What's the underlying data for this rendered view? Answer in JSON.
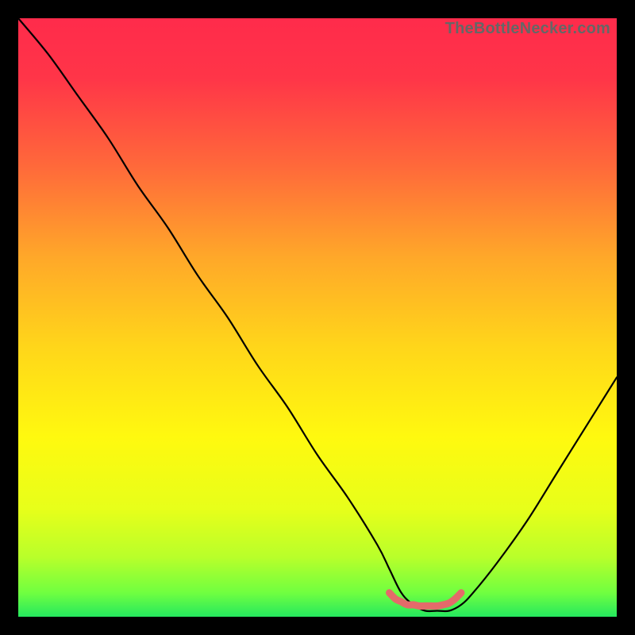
{
  "watermark": "TheBottleNecker.com",
  "chart_data": {
    "type": "line",
    "title": "",
    "xlabel": "",
    "ylabel": "",
    "xlim": [
      0,
      100
    ],
    "ylim": [
      0,
      100
    ],
    "series": [
      {
        "name": "bottleneck-curve",
        "x": [
          0,
          5,
          10,
          15,
          20,
          25,
          30,
          35,
          40,
          45,
          50,
          55,
          60,
          62,
          64,
          66,
          68,
          70,
          72,
          74,
          76,
          80,
          85,
          90,
          95,
          100
        ],
        "y": [
          100,
          94,
          87,
          80,
          72,
          65,
          57,
          50,
          42,
          35,
          27,
          20,
          12,
          8,
          4,
          2,
          1,
          1,
          1,
          2,
          4,
          9,
          16,
          24,
          32,
          40
        ]
      },
      {
        "name": "optimal-zone-marker",
        "x": [
          62,
          63,
          64,
          65,
          66,
          67,
          68,
          69,
          70,
          71,
          72,
          73,
          74
        ],
        "y": [
          4,
          3,
          2.5,
          2,
          2,
          1.8,
          1.8,
          1.8,
          1.8,
          2,
          2.3,
          3,
          4
        ]
      }
    ],
    "gradient_stops": [
      {
        "offset": 0.0,
        "color": "#ff2b4b"
      },
      {
        "offset": 0.1,
        "color": "#ff3548"
      },
      {
        "offset": 0.25,
        "color": "#ff6a3a"
      },
      {
        "offset": 0.4,
        "color": "#ffa829"
      },
      {
        "offset": 0.55,
        "color": "#ffd61a"
      },
      {
        "offset": 0.7,
        "color": "#fff90f"
      },
      {
        "offset": 0.82,
        "color": "#e7ff1a"
      },
      {
        "offset": 0.9,
        "color": "#b9ff2a"
      },
      {
        "offset": 0.96,
        "color": "#70ff40"
      },
      {
        "offset": 1.0,
        "color": "#25e85e"
      }
    ],
    "curve_color": "#000000",
    "marker_color": "#e46a6a",
    "marker_width": 9
  }
}
